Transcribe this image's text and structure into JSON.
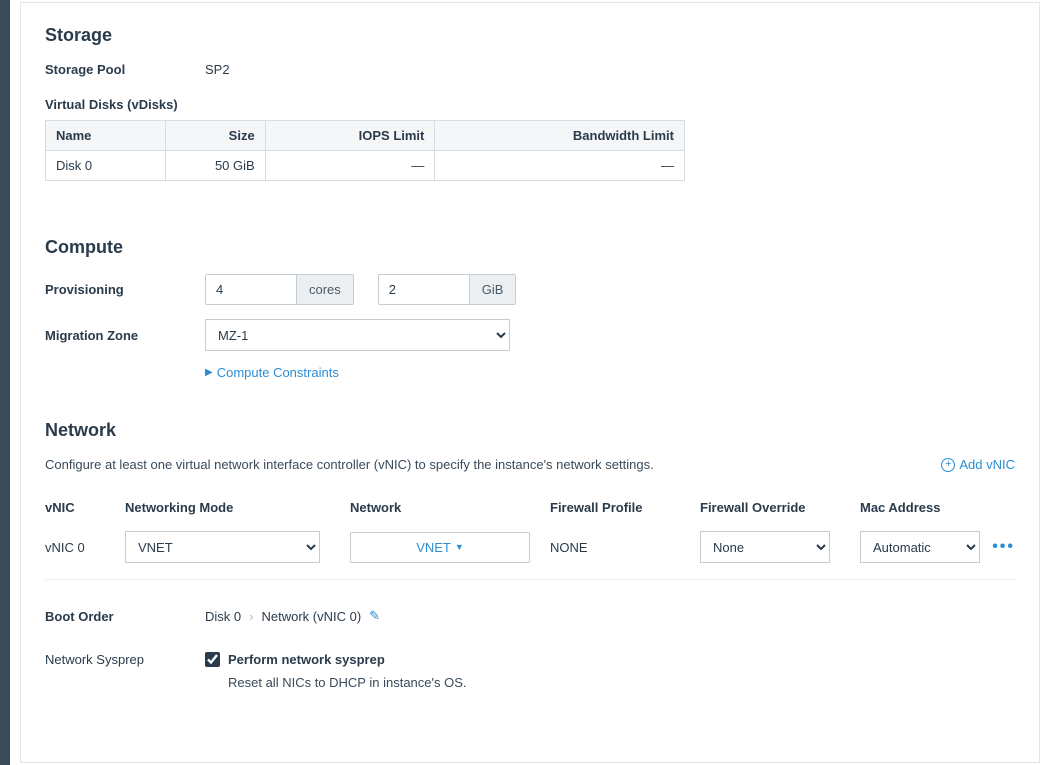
{
  "storage": {
    "title": "Storage",
    "pool_label": "Storage Pool",
    "pool_value": "SP2",
    "vdisks_label": "Virtual Disks (vDisks)",
    "headers": {
      "name": "Name",
      "size": "Size",
      "iops": "IOPS Limit",
      "bw": "Bandwidth Limit"
    },
    "disk": {
      "name": "Disk 0",
      "size": "50 GiB",
      "iops": "—",
      "bw": "—"
    }
  },
  "compute": {
    "title": "Compute",
    "provisioning_label": "Provisioning",
    "cores_value": "4",
    "cores_unit": "cores",
    "mem_value": "2",
    "mem_unit": "GiB",
    "mz_label": "Migration Zone",
    "mz_value": "MZ-1",
    "constraints_link": "Compute Constraints"
  },
  "network": {
    "title": "Network",
    "description": "Configure at least one virtual network interface controller (vNIC) to specify the instance's network settings.",
    "add_label": "Add vNIC",
    "headers": {
      "vnic": "vNIC",
      "mode": "Networking Mode",
      "network": "Network",
      "fwp": "Firewall Profile",
      "over": "Firewall Override",
      "mac": "Mac Address"
    },
    "nic": {
      "name": "vNIC 0",
      "mode": "VNET",
      "network": "VNET",
      "fwp": "NONE",
      "override": "None",
      "mac": "Automatic"
    }
  },
  "boot": {
    "label": "Boot Order",
    "step1": "Disk 0",
    "step2": "Network (vNIC 0)"
  },
  "sysprep": {
    "label": "Network Sysprep",
    "cb_label": "Perform network sysprep",
    "desc": "Reset all NICs to DHCP in instance's OS."
  }
}
